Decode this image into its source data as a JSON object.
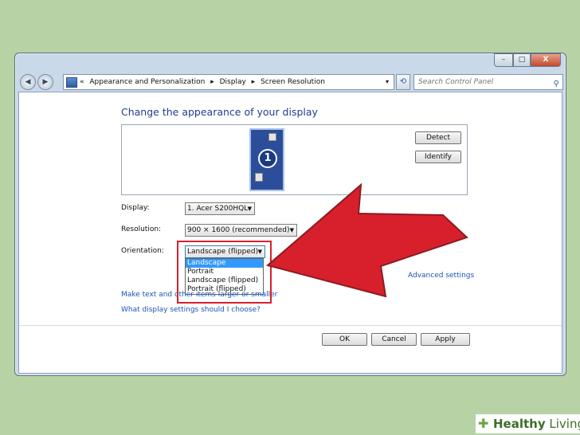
{
  "titlebar": {
    "min": "–",
    "max": "□",
    "close": "X"
  },
  "nav": {
    "back": "◀",
    "forward": "▶",
    "breadcrumb": [
      "«",
      "Appearance and Personalization",
      "▸",
      "Display",
      "▸",
      "Screen Resolution"
    ],
    "dropdown": "▾",
    "refresh": "⟲",
    "search_placeholder": "Search Control Panel",
    "search_icon": "⚲"
  },
  "content": {
    "heading": "Change the appearance of your display",
    "monitor_number": "1",
    "detect_label": "Detect",
    "identify_label": "Identify",
    "display_label": "Display:",
    "display_value": "1. Acer S200HQL",
    "resolution_label": "Resolution:",
    "resolution_value": "900 × 1600 (recommended)",
    "orientation_label": "Orientation:",
    "orientation_value": "Landscape (flipped)",
    "orientation_options": [
      "Landscape",
      "Portrait",
      "Landscape (flipped)",
      "Portrait (flipped)"
    ],
    "advanced_link": "Advanced settings",
    "make_text_link": "Make text and other items larger or smaller",
    "what_settings_link": "What display settings should I choose?",
    "ok_label": "OK",
    "cancel_label": "Cancel",
    "apply_label": "Apply"
  },
  "colors": {
    "arrow": "#d8202d",
    "link": "#1a55b5",
    "heading": "#1e3d8f",
    "selection": "#3399ff"
  },
  "brand": {
    "icon": "✚",
    "name_bold": "Healthy",
    "name": " Living"
  }
}
